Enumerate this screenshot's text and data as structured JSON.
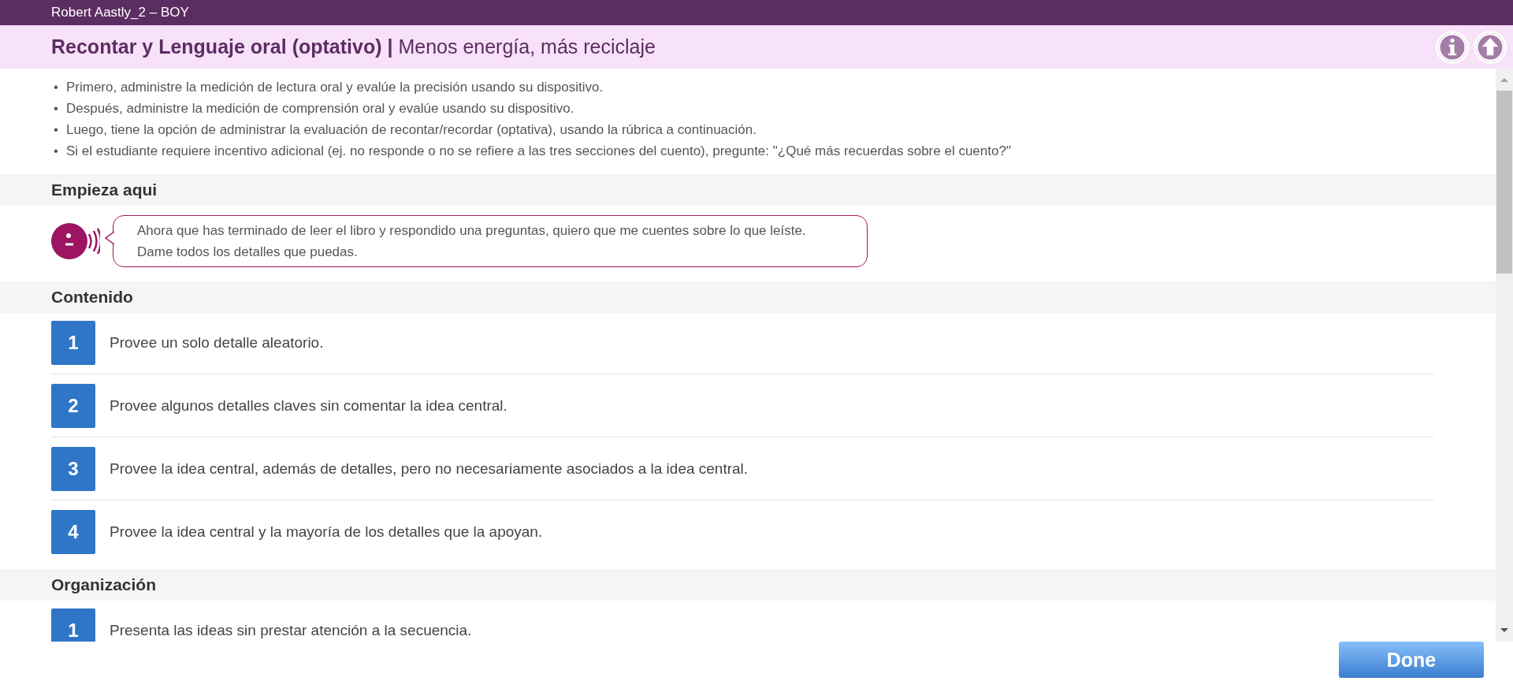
{
  "window": {
    "title": "Robert Aastly_2 – BOY"
  },
  "header": {
    "title": "Recontar y Lenguaje oral (optativo)",
    "separator": "|",
    "subtitle": "Menos energía, más reciclaje"
  },
  "instructions": [
    {
      "marker": "•",
      "text": "Primero, administre la medición de lectura oral y evalúe la precisión usando su dispositivo."
    },
    {
      "marker": "•",
      "text": "Después, administre la medición de comprensión oral y evalúe usando su dispositivo."
    },
    {
      "marker": "•",
      "text": "Luego, tiene la opción de administrar la evaluación de recontar/recordar (optativa), usando la rúbrica a continuación."
    },
    {
      "marker": "•",
      "text": "Si el estudiante requiere incentivo adicional (ej. no responde o no se refiere a las tres secciones del cuento), pregunte: \"¿Qué más recuerdas sobre el cuento?\""
    }
  ],
  "sections": [
    {
      "kind": "prompt",
      "title": "Empieza aqui",
      "prompt": "Ahora que has terminado de leer el libro y respondido una preguntas, quiero que me cuentes sobre lo que leíste. Dame todos los detalles que puedas."
    },
    {
      "kind": "rubric",
      "title": "Contenido",
      "items": [
        {
          "score": "1",
          "text": "Provee un solo detalle aleatorio."
        },
        {
          "score": "2",
          "text": "Provee algunos detalles claves sin comentar la idea central."
        },
        {
          "score": "3",
          "text": "Provee la idea central, además de detalles, pero no necesariamente asociados a la idea central."
        },
        {
          "score": "4",
          "text": "Provee la idea central y la mayoría de los detalles que la apoyan."
        }
      ]
    },
    {
      "kind": "rubric",
      "title": "Organización",
      "items": [
        {
          "score": "1",
          "text": "Presenta las ideas sin prestar atención a la secuencia."
        }
      ]
    }
  ],
  "done_button": "Done"
}
